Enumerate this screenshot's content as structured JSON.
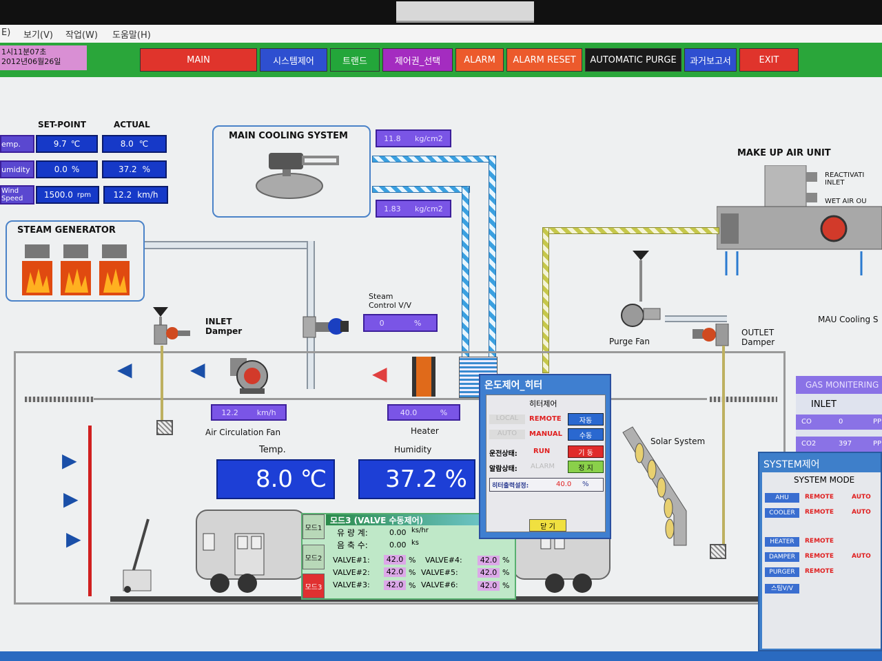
{
  "menu": {
    "item_file_fragment": "E)",
    "item_view": "보기(V)",
    "item_work": "작업(W)",
    "item_help": "도움말(H)"
  },
  "clock": {
    "time": "1시11분07초",
    "date": "2012년06월26일"
  },
  "nav": [
    {
      "label": "MAIN",
      "color": "#e0342c"
    },
    {
      "label": "시스템제어",
      "color": "#2e4fd0"
    },
    {
      "label": "트랜드",
      "color": "#23a63a"
    },
    {
      "label": "제어권_선택",
      "color": "#a42cc0"
    },
    {
      "label": "ALARM",
      "color": "#ec5a2c"
    },
    {
      "label": "ALARM RESET",
      "color": "#ec5a2c"
    },
    {
      "label": "AUTOMATIC PURGE",
      "color": "#1a1a1a"
    },
    {
      "label": "과거보고서",
      "color": "#2e4fd0"
    },
    {
      "label": "EXIT",
      "color": "#e0342c"
    }
  ],
  "setpoint": {
    "header_set": "SET-POINT",
    "header_actual": "ACTUAL",
    "rows": [
      {
        "label": "emp.",
        "set": "9.7",
        "set_unit": "℃",
        "actual": "8.0",
        "actual_unit": "℃"
      },
      {
        "label": "umidity",
        "set": "0.0",
        "set_unit": "%",
        "actual": "37.2",
        "actual_unit": "%"
      },
      {
        "label": "Wind Speed",
        "set": "1500.0",
        "set_unit": "rpm",
        "actual": "12.2",
        "actual_unit": "km/h"
      }
    ]
  },
  "main_cooling": {
    "title": "MAIN COOLING SYSTEM",
    "p1": "11.8",
    "p1_unit": "kg/cm2",
    "p2": "1.83",
    "p2_unit": "kg/cm2"
  },
  "steam_generator": {
    "title": "STEAM GENERATOR"
  },
  "inlet_damper": {
    "label1": "INLET",
    "label2": "Damper"
  },
  "steam_control": {
    "label1": "Steam",
    "label2": "Control V/V",
    "value": "0",
    "unit": "%"
  },
  "mau": {
    "title": "MAKE  UP AIR UNIT",
    "reactivation": "REACTIVATI",
    "inlet": "INLET",
    "wet_air": "WET AIR OU",
    "cooling": "MAU Cooling S"
  },
  "purge_fan": {
    "label": "Purge Fan"
  },
  "outlet_damper": {
    "label1": "OUTLET",
    "label2": "Damper"
  },
  "air_circ": {
    "label": "Air Circulation Fan",
    "value": "12.2",
    "unit": "km/h"
  },
  "heater": {
    "label": "Heater",
    "value": "40.0",
    "unit": "%"
  },
  "temp": {
    "label": "Temp.",
    "value": "8.0 ℃"
  },
  "humidity": {
    "label": "Humidity",
    "value": "37.2 %"
  },
  "solar": {
    "label": "Solar System"
  },
  "gas": {
    "title": "GAS MONITERING",
    "inlet": "INLET",
    "rows": [
      {
        "name": "CO",
        "value": "0",
        "unit": "PP"
      },
      {
        "name": "CO2",
        "value": "397",
        "unit": "PP"
      }
    ]
  },
  "heater_dialog": {
    "title": "온도제어_히터",
    "subtitle": "히터제어",
    "local": "LOCAL",
    "remote": "REMOTE",
    "auto_btn": "자동",
    "auto": "AUTO",
    "manual": "MANUAL",
    "manual_btn": "수동",
    "run_label": "운전상태:",
    "run_value": "RUN",
    "start_btn": "기 동",
    "alarm_label": "알람상태:",
    "alarm_value": "ALARM",
    "stop_btn": "정 지",
    "output_label": "히터출력설정:",
    "output_value": "40.0",
    "output_unit": "%",
    "close_btn": "닫 기"
  },
  "mode_panel": {
    "title": "모드3 (VALVE 수동제어)",
    "tabs": [
      "모드1",
      "모드2",
      "모드3"
    ],
    "flow_label": "유 량 계:",
    "flow_value": "0.00",
    "flow_unit": "ks/hr",
    "accum_label": "음 축 수:",
    "accum_value": "0.00",
    "accum_unit": "ks",
    "valves": [
      {
        "name": "VALVE#1:",
        "value": "42.0",
        "unit": "%"
      },
      {
        "name": "VALVE#2:",
        "value": "42.0",
        "unit": "%"
      },
      {
        "name": "VALVE#3:",
        "value": "42.0",
        "unit": "%"
      },
      {
        "name": "VALVE#4:",
        "value": "42.0",
        "unit": "%"
      },
      {
        "name": "VALVE#5:",
        "value": "42.0",
        "unit": "%"
      },
      {
        "name": "VALVE#6:",
        "value": "42.0",
        "unit": "%"
      }
    ]
  },
  "system_panel": {
    "title": "SYSTEM제어",
    "mode_header": "SYSTEM MODE",
    "rows": [
      {
        "name": "AHU",
        "mode": "REMOTE",
        "state": "AUTO"
      },
      {
        "name": "COOLER",
        "mode": "REMOTE",
        "state": "AUTO"
      },
      {
        "name": "HEATER",
        "mode": "REMOTE",
        "state": ""
      },
      {
        "name": "DAMPER",
        "mode": "REMOTE",
        "state": "AUTO"
      },
      {
        "name": "PURGER",
        "mode": "REMOTE",
        "state": ""
      },
      {
        "name": "스팀V/V",
        "mode": "",
        "state": ""
      }
    ]
  }
}
